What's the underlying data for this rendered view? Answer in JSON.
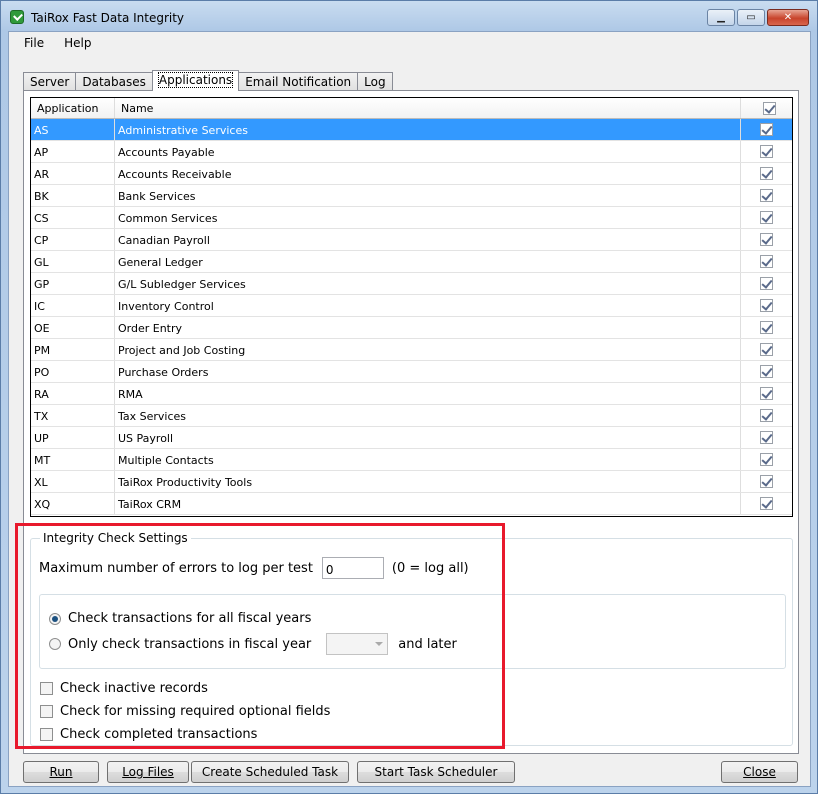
{
  "window": {
    "title": "TaiRox Fast Data Integrity",
    "icon": "tairox-check-icon",
    "controls": [
      "minimize",
      "maximize",
      "close"
    ]
  },
  "menu": [
    {
      "label": "File"
    },
    {
      "label": "Help"
    }
  ],
  "tabs": [
    {
      "label": "Server",
      "active": false
    },
    {
      "label": "Databases",
      "active": false
    },
    {
      "label": "Applications",
      "active": true
    },
    {
      "label": "Email Notification",
      "active": false
    },
    {
      "label": "Log",
      "active": false
    }
  ],
  "grid": {
    "columns": {
      "application": "Application",
      "name": "Name",
      "all_checked": true
    },
    "rows": [
      {
        "code": "AS",
        "name": "Administrative Services",
        "checked": true,
        "selected": true
      },
      {
        "code": "AP",
        "name": "Accounts Payable",
        "checked": true
      },
      {
        "code": "AR",
        "name": "Accounts Receivable",
        "checked": true
      },
      {
        "code": "BK",
        "name": "Bank Services",
        "checked": true
      },
      {
        "code": "CS",
        "name": "Common Services",
        "checked": true
      },
      {
        "code": "CP",
        "name": "Canadian Payroll",
        "checked": true
      },
      {
        "code": "GL",
        "name": "General Ledger",
        "checked": true
      },
      {
        "code": "GP",
        "name": "G/L Subledger Services",
        "checked": true
      },
      {
        "code": "IC",
        "name": "Inventory Control",
        "checked": true
      },
      {
        "code": "OE",
        "name": "Order Entry",
        "checked": true
      },
      {
        "code": "PM",
        "name": "Project and Job Costing",
        "checked": true
      },
      {
        "code": "PO",
        "name": "Purchase Orders",
        "checked": true
      },
      {
        "code": "RA",
        "name": "RMA",
        "checked": true
      },
      {
        "code": "TX",
        "name": "Tax Services",
        "checked": true
      },
      {
        "code": "UP",
        "name": "US Payroll",
        "checked": true
      },
      {
        "code": "MT",
        "name": "Multiple Contacts",
        "checked": true
      },
      {
        "code": "XL",
        "name": "TaiRox Productivity Tools",
        "checked": true
      },
      {
        "code": "XQ",
        "name": "TaiRox CRM",
        "checked": true
      }
    ]
  },
  "settings": {
    "legend": "Integrity Check Settings",
    "max_errors_label": "Maximum number of errors to log per test",
    "max_errors_value": "0",
    "max_errors_hint": "(0 = log all)",
    "radio_all_years": "Check transactions for all fiscal years",
    "radio_only_year": "Only check transactions in fiscal year",
    "year_value": "",
    "and_later": "and later",
    "selected_radio": "all_years",
    "check_inactive": "Check inactive records",
    "check_missing_fields": "Check for missing required optional fields",
    "check_completed": "Check completed transactions",
    "inactive_checked": false,
    "missing_checked": false,
    "completed_checked": false
  },
  "buttons": {
    "run": "Run",
    "log_files": "Log Files",
    "create_task": "Create Scheduled Task",
    "start_scheduler": "Start Task Scheduler",
    "close": "Close"
  },
  "colors": {
    "selection": "#3399ff",
    "highlight_box": "#e8192c"
  }
}
